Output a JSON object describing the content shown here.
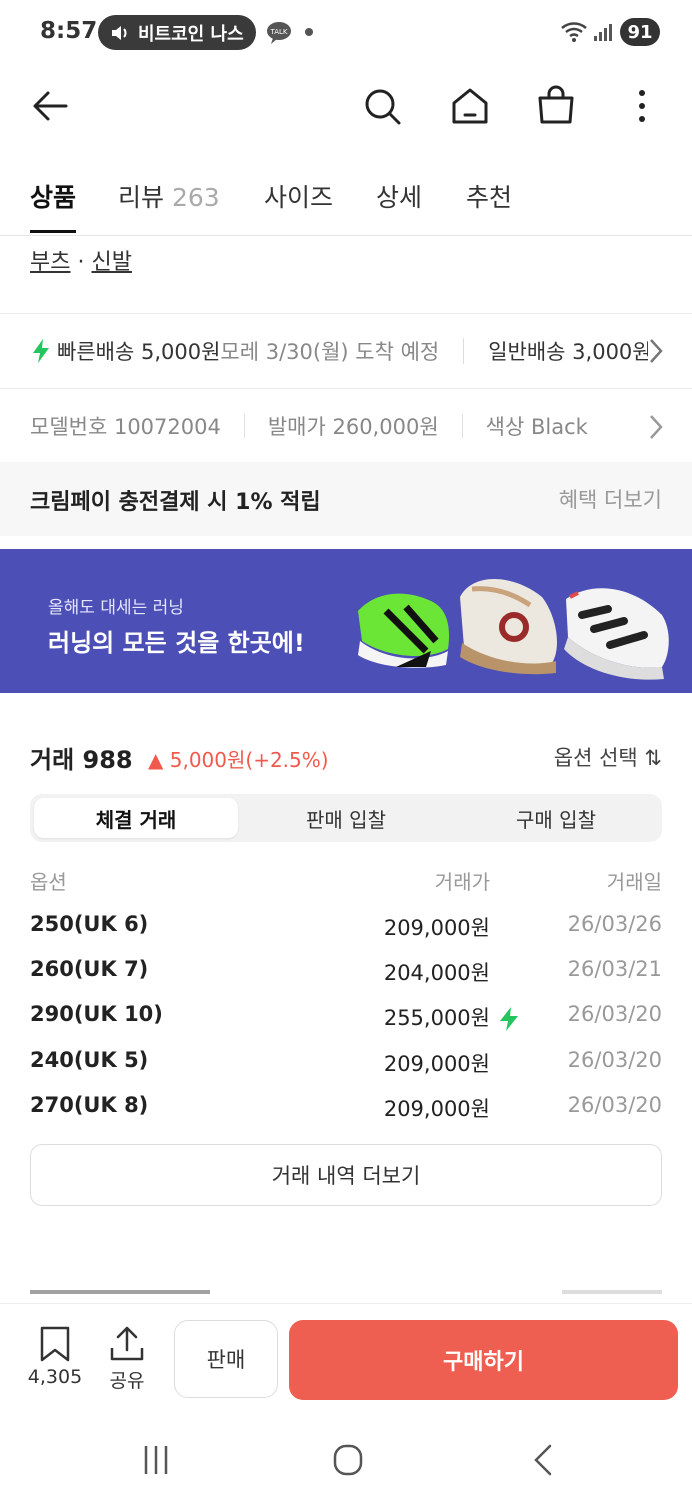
{
  "status_bar": {
    "time": "8:57",
    "media_text": "비트코인 나스",
    "talk_text": "TALK",
    "battery": "91"
  },
  "app_bar": {
    "icons": [
      "back-arrow-icon",
      "search-icon",
      "home-icon",
      "shopping-bag-icon",
      "more-vert-icon"
    ]
  },
  "tabs": {
    "product": "상품",
    "review": "리뷰",
    "review_count": "263",
    "size": "사이즈",
    "detail": "상세",
    "recommend": "추천"
  },
  "category": {
    "first": "부츠",
    "sep": " · ",
    "second": "신발"
  },
  "delivery": {
    "fast_label": "빠른배송 5,000원",
    "fast_eta": " 모레 3/30(월) 도착 예정",
    "normal_label": "일반배송 3,000원"
  },
  "model": {
    "model_no": "모델번호 10072004",
    "release_price": "발매가 260,000원",
    "color": "색상 Black"
  },
  "benefit": {
    "title": "크림페이 충전결제 시 1% 적립",
    "more": "혜택 더보기"
  },
  "banner": {
    "sub": "올해도 대세는 러닝",
    "main": "러닝의 모든 것을 한곳에!"
  },
  "trade": {
    "title": "거래 988",
    "change": "▲ 5,000원(+2.5%)",
    "option_select": "옵션 선택 ⇅",
    "segments": [
      "체결 거래",
      "판매 입찰",
      "구매 입찰"
    ],
    "active_segment": 0,
    "headers": [
      "옵션",
      "거래가",
      "거래일"
    ],
    "rows": [
      {
        "option": "250(UK 6)",
        "price": "209,000원",
        "date": "26/03/26",
        "fast": false
      },
      {
        "option": "260(UK 7)",
        "price": "204,000원",
        "date": "26/03/21",
        "fast": false
      },
      {
        "option": "290(UK 10)",
        "price": "255,000원",
        "date": "26/03/20",
        "fast": true
      },
      {
        "option": "240(UK 5)",
        "price": "209,000원",
        "date": "26/03/20",
        "fast": false
      },
      {
        "option": "270(UK 8)",
        "price": "209,000원",
        "date": "26/03/20",
        "fast": false
      }
    ],
    "more_button": "거래 내역 더보기"
  },
  "bottom_bar": {
    "bookmark_count": "4,305",
    "share_label": "공유",
    "sell_label": "판매",
    "buy_label": "구매하기"
  },
  "colors": {
    "accent_red": "#ef5f51",
    "banner_bg": "#4c4fb5",
    "fast_green": "#22c55e",
    "up_red": "#ef5a4d"
  }
}
